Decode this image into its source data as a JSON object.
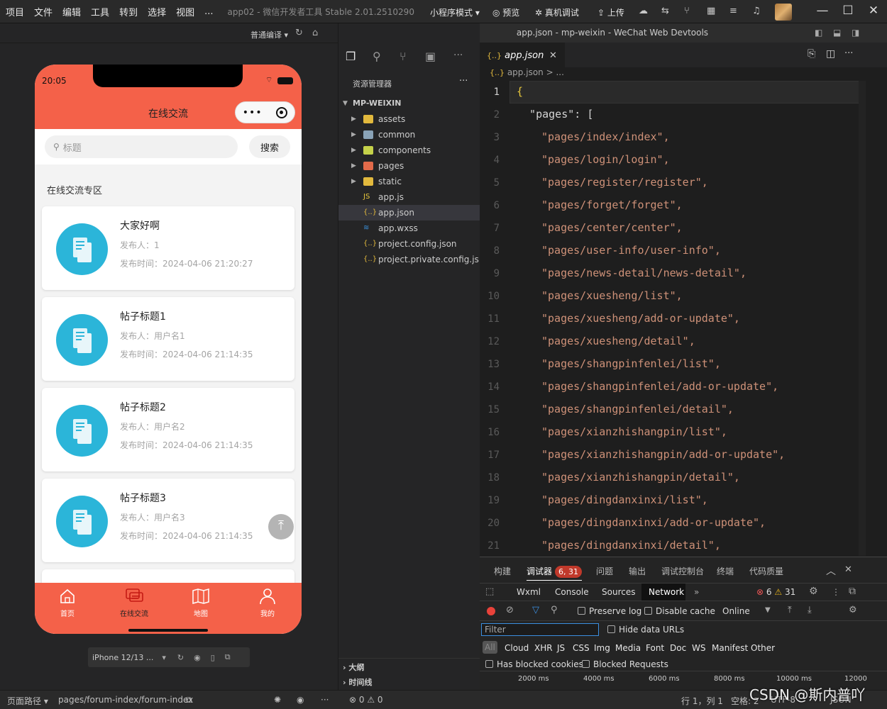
{
  "menu": [
    "项目",
    "文件",
    "编辑",
    "工具",
    "转到",
    "选择",
    "视图",
    "..."
  ],
  "window_title": "app02 - 微信开发者工具 Stable 2.01.2510290",
  "mode_label": "小程序模式",
  "toolbar": {
    "preview": "预览",
    "remote_debug": "真机调试",
    "upload": "上传"
  },
  "simulator": {
    "compile_mode": "普通编译",
    "status_time": "20:05",
    "nav_title": "在线交流",
    "search_placeholder": "标题",
    "search_button": "搜索",
    "section_title": "在线交流专区",
    "posts": [
      {
        "title": "大家好啊",
        "publisher": "发布人：1",
        "time": "发布时间：2024-04-06 21:20:27"
      },
      {
        "title": "帖子标题1",
        "publisher": "发布人：用户名1",
        "time": "发布时间：2024-04-06 21:14:35"
      },
      {
        "title": "帖子标题2",
        "publisher": "发布人：用户名2",
        "time": "发布时间：2024-04-06 21:14:35"
      },
      {
        "title": "帖子标题3",
        "publisher": "发布人：用户名3",
        "time": "发布时间：2024-04-06 21:14:35"
      }
    ],
    "tabs": [
      "首页",
      "在线交流",
      "地图",
      "我的"
    ],
    "device": "iPhone 12/13 ..."
  },
  "explorer": {
    "title": "资源管理器",
    "root": "MP-WEIXIN",
    "items": [
      {
        "name": "assets",
        "type": "folder",
        "color": "#e2b93d"
      },
      {
        "name": "common",
        "type": "folder",
        "color": "#8aa3b7"
      },
      {
        "name": "components",
        "type": "folder",
        "color": "#c5d24a"
      },
      {
        "name": "pages",
        "type": "folder",
        "color": "#e26a4a"
      },
      {
        "name": "static",
        "type": "folder",
        "color": "#e2b93d"
      },
      {
        "name": "app.js",
        "type": "js",
        "color": "#e8c83c"
      },
      {
        "name": "app.json",
        "type": "json",
        "color": "#e2b93d"
      },
      {
        "name": "app.wxss",
        "type": "css",
        "color": "#3a8fd9"
      },
      {
        "name": "project.config.json",
        "type": "json",
        "color": "#e2b93d"
      },
      {
        "name": "project.private.config.js...",
        "type": "json",
        "color": "#e2b93d"
      }
    ],
    "outline": "大纲",
    "timeline": "时间线"
  },
  "editor": {
    "title": "app.json - mp-weixin - WeChat Web Devtools",
    "tab": "app.json",
    "breadcrumb": "app.json > ...",
    "lines": [
      {
        "n": "1",
        "text": "{"
      },
      {
        "n": "2",
        "text": "  \"pages\": ["
      },
      {
        "n": "3",
        "text": "\"pages/index/index\","
      },
      {
        "n": "4",
        "text": "\"pages/login/login\","
      },
      {
        "n": "5",
        "text": "\"pages/register/register\","
      },
      {
        "n": "6",
        "text": "\"pages/forget/forget\","
      },
      {
        "n": "7",
        "text": "\"pages/center/center\","
      },
      {
        "n": "8",
        "text": "\"pages/user-info/user-info\","
      },
      {
        "n": "9",
        "text": "\"pages/news-detail/news-detail\","
      },
      {
        "n": "10",
        "text": "\"pages/xuesheng/list\","
      },
      {
        "n": "11",
        "text": "\"pages/xuesheng/add-or-update\","
      },
      {
        "n": "12",
        "text": "\"pages/xuesheng/detail\","
      },
      {
        "n": "13",
        "text": "\"pages/shangpinfenlei/list\","
      },
      {
        "n": "14",
        "text": "\"pages/shangpinfenlei/add-or-update\","
      },
      {
        "n": "15",
        "text": "\"pages/shangpinfenlei/detail\","
      },
      {
        "n": "16",
        "text": "\"pages/xianzhishangpin/list\","
      },
      {
        "n": "17",
        "text": "\"pages/xianzhishangpin/add-or-update\","
      },
      {
        "n": "18",
        "text": "\"pages/xianzhishangpin/detail\","
      },
      {
        "n": "19",
        "text": "\"pages/dingdanxinxi/list\","
      },
      {
        "n": "20",
        "text": "\"pages/dingdanxinxi/add-or-update\","
      },
      {
        "n": "21",
        "text": "\"pages/dingdanxinxi/detail\","
      }
    ]
  },
  "devtools": {
    "tabs": [
      "构建",
      "调试器",
      "问题",
      "输出",
      "调试控制台",
      "终端",
      "代码质量"
    ],
    "badge": "6, 31",
    "panels": [
      "Wxml",
      "Console",
      "Sources",
      "Network"
    ],
    "errors": "6",
    "warnings": "31",
    "preserve_log": "Preserve log",
    "disable_cache": "Disable cache",
    "throttle": "Online",
    "filter_placeholder": "Filter",
    "hide_data_urls": "Hide data URLs",
    "types": [
      "All",
      "Cloud",
      "XHR",
      "JS",
      "CSS",
      "Img",
      "Media",
      "Font",
      "Doc",
      "WS",
      "Manifest",
      "Other"
    ],
    "has_blocked": "Has blocked cookies",
    "blocked_requests": "Blocked Requests",
    "ticks": [
      "2000 ms",
      "4000 ms",
      "6000 ms",
      "8000 ms",
      "10000 ms",
      "12000"
    ]
  },
  "statusbar": {
    "path_label": "页面路径",
    "path": "pages/forum-index/forum-index",
    "problems": "0",
    "warnings": "0",
    "position": "行 1，列 1",
    "spaces": "空格: 2",
    "encoding": "UTF-8",
    "lang": "JSON",
    "watermark": "CSDN @斯内普吖"
  }
}
